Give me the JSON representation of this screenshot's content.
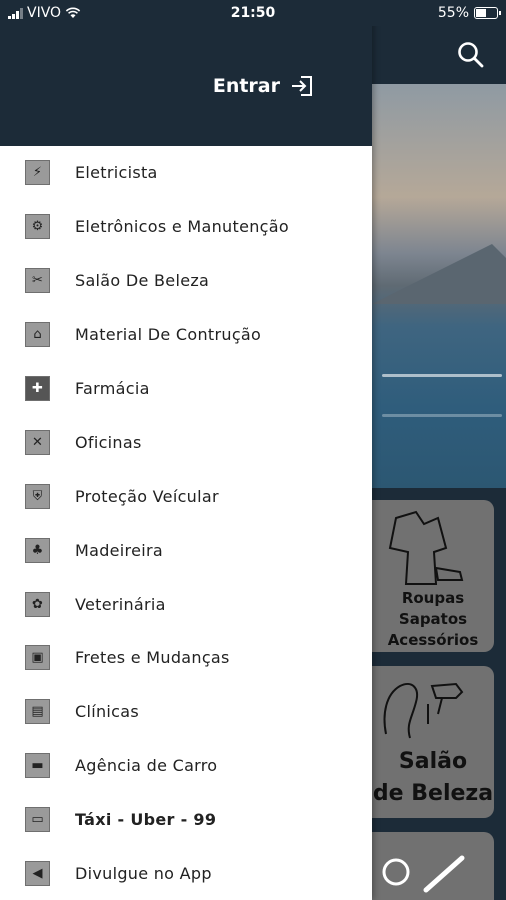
{
  "status_bar": {
    "carrier": "VIVO",
    "time": "21:50",
    "battery": "55%",
    "battery_level": 0.55
  },
  "drawer": {
    "login_label": "Entrar",
    "items": [
      {
        "label": "Eletricista",
        "icon": "electrician-icon",
        "glyph": "⚡"
      },
      {
        "label": "Eletrônicos e Manutenção",
        "icon": "electronics-icon",
        "glyph": "⚙"
      },
      {
        "label": "Salão De Beleza",
        "icon": "beauty-salon-icon",
        "glyph": "✂"
      },
      {
        "label": "Material De Contrução",
        "icon": "construction-material-icon",
        "glyph": "⌂"
      },
      {
        "label": "Farmácia",
        "icon": "pharmacy-icon",
        "glyph": "✚"
      },
      {
        "label": "Oficinas",
        "icon": "workshop-icon",
        "glyph": "✕"
      },
      {
        "label": "Proteção Veícular",
        "icon": "vehicle-protection-icon",
        "glyph": "⛨"
      },
      {
        "label": "Madeireira",
        "icon": "lumber-icon",
        "glyph": "♣"
      },
      {
        "label": "Veterinária",
        "icon": "veterinary-icon",
        "glyph": "✿"
      },
      {
        "label": "Fretes e Mudanças",
        "icon": "moving-truck-icon",
        "glyph": "▣"
      },
      {
        "label": "Clínicas",
        "icon": "clinic-icon",
        "glyph": "▤"
      },
      {
        "label": "Agência de Carro",
        "icon": "car-agency-icon",
        "glyph": "▬"
      },
      {
        "label": "Táxi - Uber - 99",
        "icon": "taxi-icon",
        "glyph": "▭"
      },
      {
        "label": "Divulgue no App",
        "icon": "megaphone-icon",
        "glyph": "◀"
      }
    ]
  },
  "cards": {
    "card1_lines": [
      "Roupas",
      "Sapatos",
      "Acessórios"
    ],
    "card2_lines": [
      "Salão",
      "de Beleza"
    ]
  },
  "colors": {
    "header": "#1c2b38",
    "card": "#717171"
  }
}
